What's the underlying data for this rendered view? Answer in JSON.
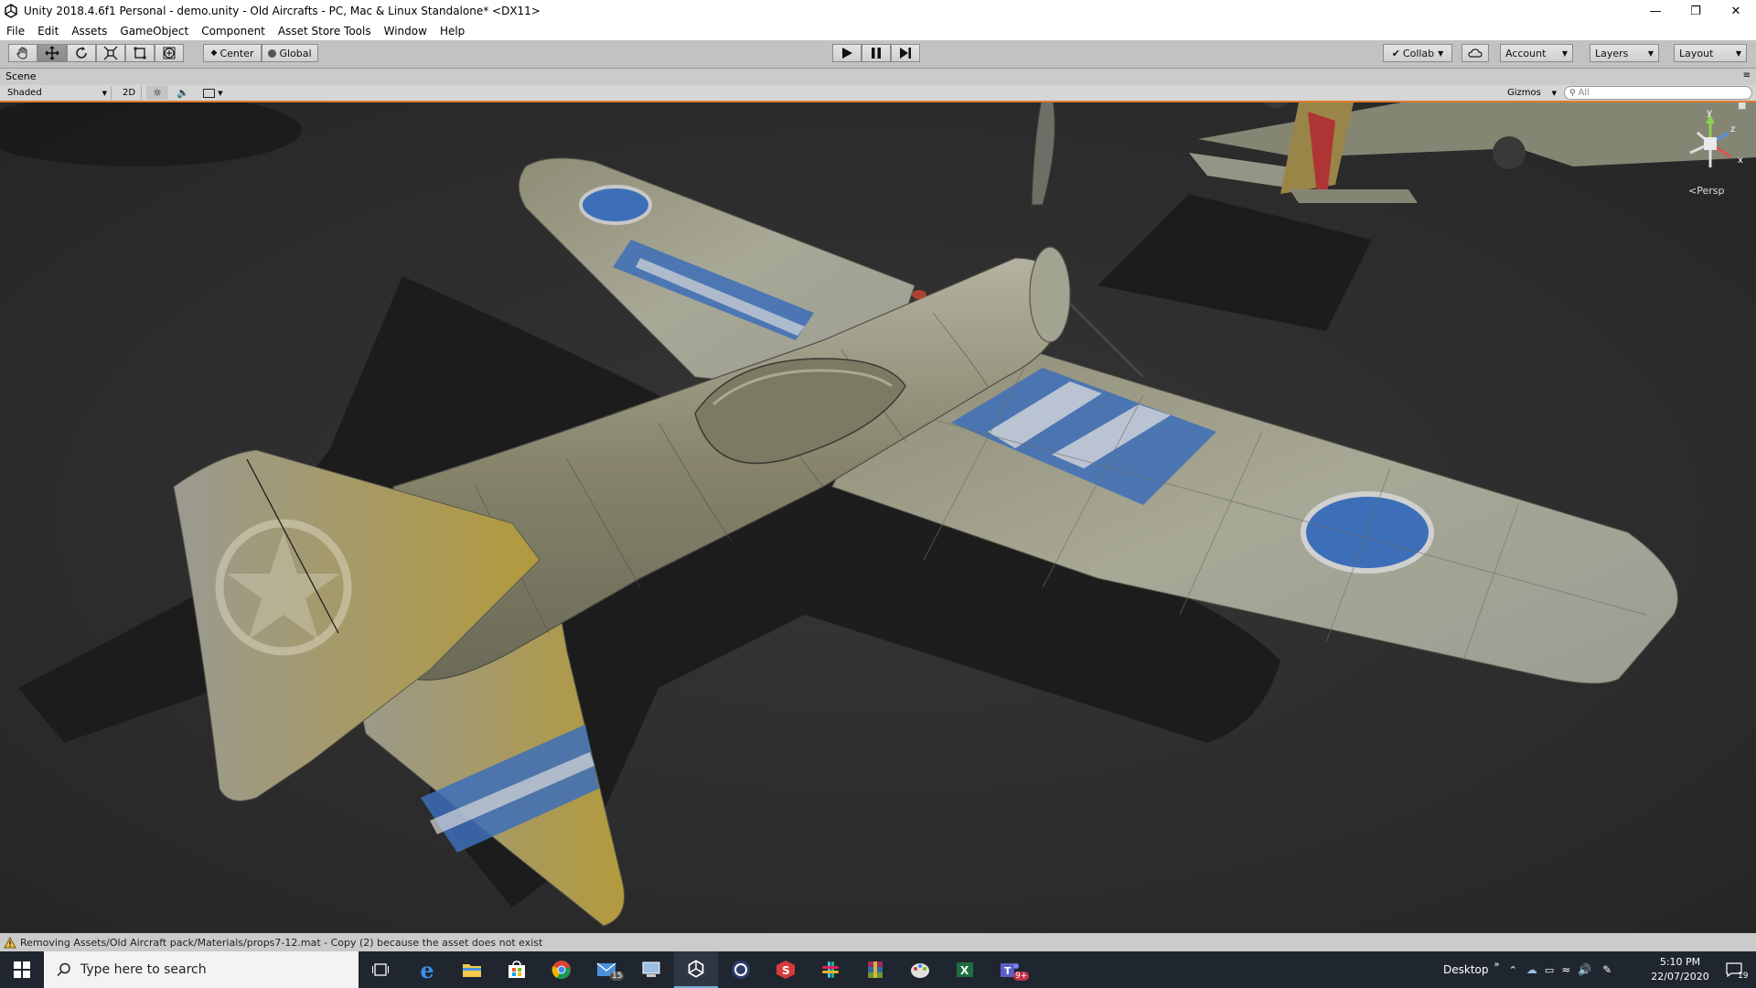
{
  "window": {
    "title": "Unity 2018.4.6f1 Personal - demo.unity - Old Aircrafts - PC, Mac & Linux Standalone* <DX11>",
    "minimize_icon": "minimize-icon",
    "maximize_icon": "restore-icon",
    "close_icon": "close-icon"
  },
  "menu": [
    "File",
    "Edit",
    "Assets",
    "GameObject",
    "Component",
    "Asset Store Tools",
    "Window",
    "Help"
  ],
  "toolbar": {
    "tools": [
      "hand-icon",
      "move-icon",
      "rotate-icon",
      "scale-icon",
      "rect-icon",
      "transform-icon"
    ],
    "pivot_label": "Center",
    "space_label": "Global",
    "collab_label": "Collab",
    "account_label": "Account",
    "layers_label": "Layers",
    "layout_label": "Layout"
  },
  "scene": {
    "tab_label": "Scene",
    "shading_mode": "Shaded",
    "mode_2d": "2D",
    "gizmos_label": "Gizmos",
    "search_placeholder": "All",
    "persp_label": "Persp",
    "gizmo_axes": {
      "y": "y",
      "z": "z",
      "x": "x"
    }
  },
  "status": {
    "message": "Removing Assets/Old Aircraft pack/Materials/props7-12.mat - Copy (2) because the asset does not exist"
  },
  "taskbar": {
    "search_placeholder": "Type here to search",
    "mail_badge": "15",
    "desktop_label": "Desktop",
    "time": "5:10 PM",
    "date": "22/07/2020",
    "notification_count": "19",
    "teams_badge": "9+"
  },
  "colors": {
    "accent_orange": "#e07a2e",
    "roundel_blue": "#3d6fb8",
    "fuselage": "#8c8b70",
    "ground": "#2e2e2e"
  }
}
